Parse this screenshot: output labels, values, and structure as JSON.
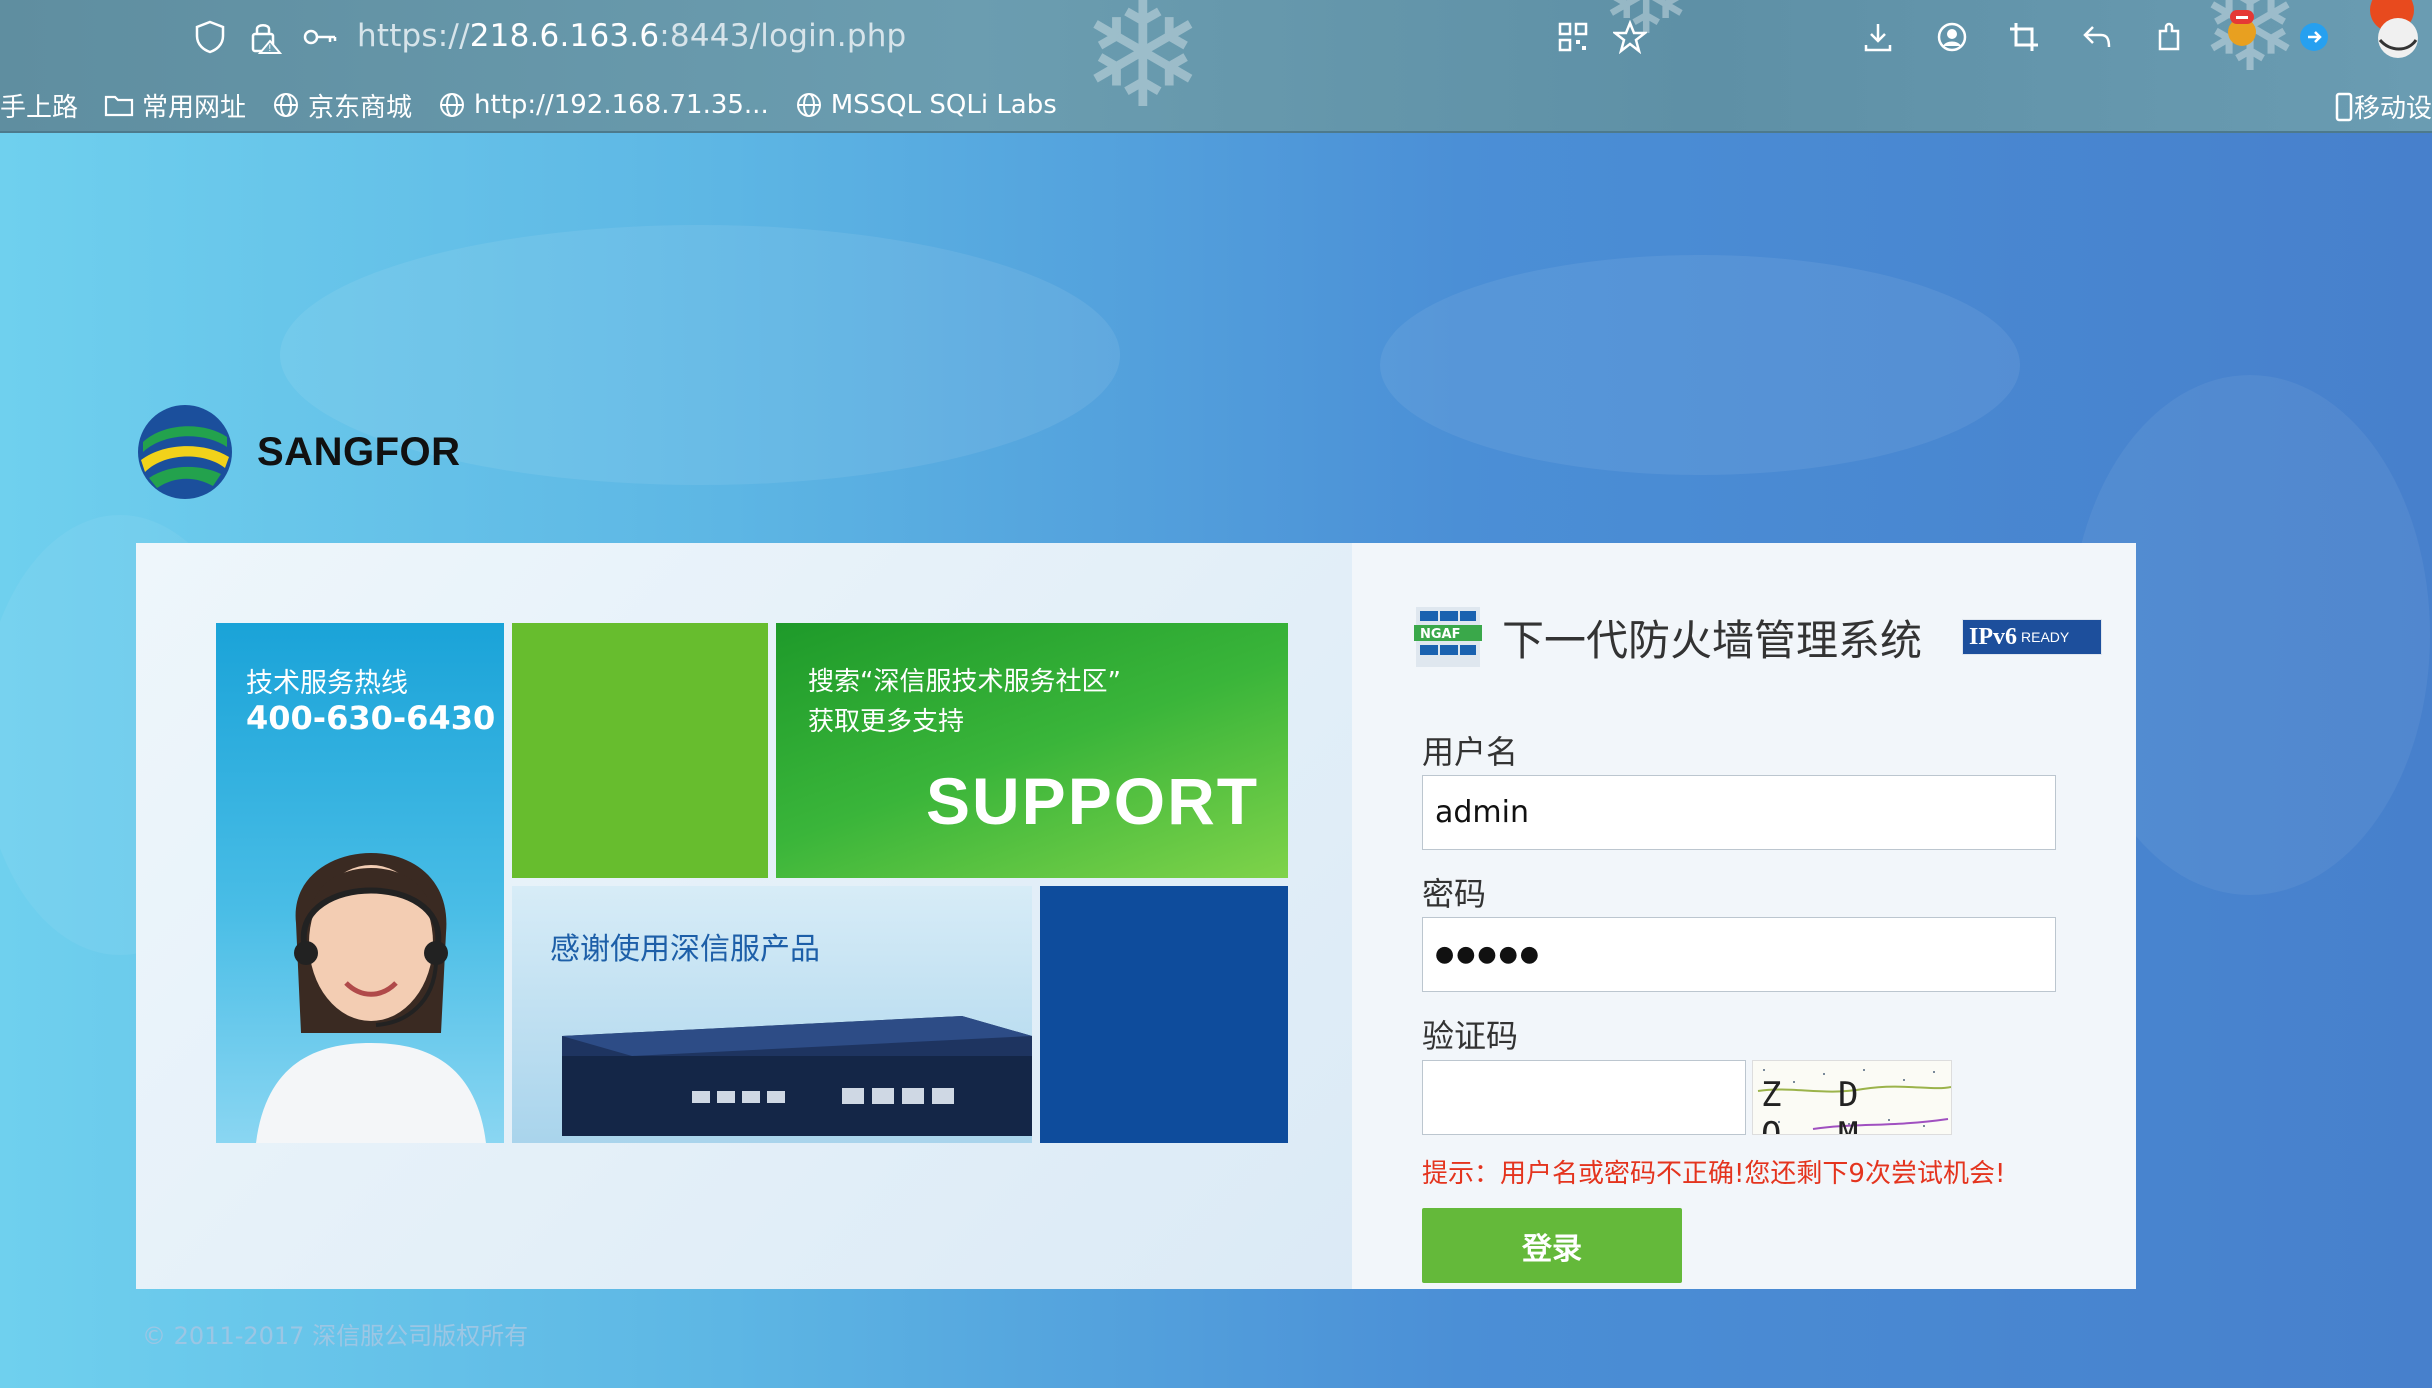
{
  "browser": {
    "url_scheme": "https://",
    "url_host": "218.6.163.6",
    "url_rest": ":8443/login.php",
    "bookmarks": [
      {
        "label": "手上路",
        "icon": "none"
      },
      {
        "label": "常用网址",
        "icon": "folder-icon"
      },
      {
        "label": "京东商城",
        "icon": "globe-icon"
      },
      {
        "label": "http://192.168.71.35...",
        "icon": "globe-icon"
      },
      {
        "label": "MSSQL SQLi Labs",
        "icon": "globe-icon"
      }
    ],
    "mobile_bookmarks": "移动设"
  },
  "brand": {
    "name": "SANGFOR"
  },
  "tiles": {
    "hotline_title": "技术服务热线",
    "hotline_number": "400-630-6430",
    "support_line1": "搜索“深信服技术服务社区”",
    "support_line2": "获取更多支持",
    "support_word": "SUPPORT",
    "product_text": "感谢使用深信服产品"
  },
  "login": {
    "ngaf_badge": "NGAF",
    "system_title": "下一代防火墙管理系统",
    "ipv6_badge": "IPv6",
    "ipv6_ready": "READY",
    "username_label": "用户名",
    "username_value": "admin",
    "password_label": "密码",
    "password_value": "●●●●●",
    "captcha_label": "验证码",
    "captcha_value": "",
    "captcha_image_text": "Z D Q M",
    "error_message": "提示：用户名或密码不正确!您还剩下9次尝试机会!",
    "login_button": "登录"
  },
  "footer": {
    "copyright": "© 2011-2017 深信服公司版权所有"
  },
  "colors": {
    "accent_green": "#64b93a",
    "error_red": "#e4341e",
    "tile_blue": "#0e4c9c"
  }
}
